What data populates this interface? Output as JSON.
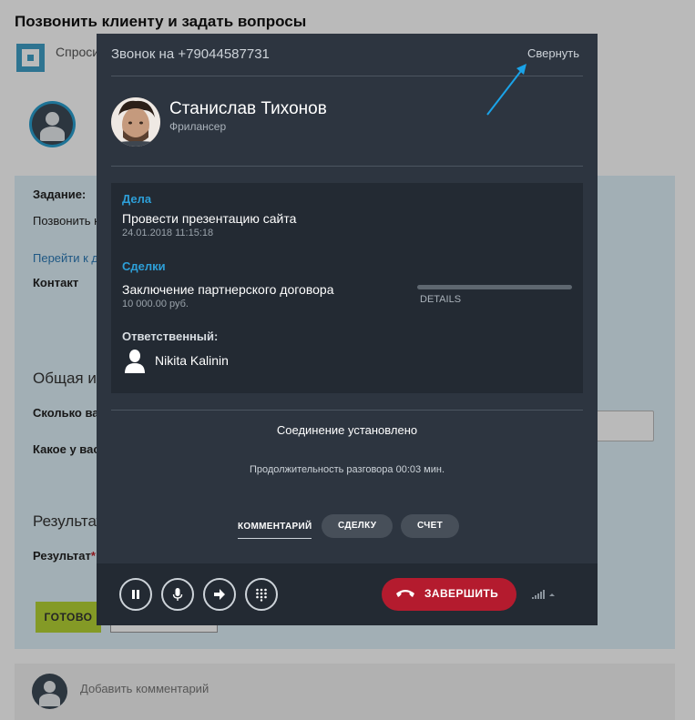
{
  "background": {
    "page_title": "Позвонить клиенту и задать вопросы",
    "ask_text": "Спроси",
    "task_label": "Задание:",
    "task_text": "Позвонить к",
    "goto_link": "Перейти к д",
    "contact_label": "Контакт",
    "general_heading": "Общая ин",
    "question1": "Сколько ва",
    "question2": "Какое у вас",
    "result_heading": "Результат",
    "result_label": "Результат",
    "required_mark": "*",
    "ready_button": "ГОТОВО",
    "add_comment": "Добавить комментарий"
  },
  "call_dialog": {
    "title": "Звонок на +79044587731",
    "collapse_label": "Свернуть",
    "caller": {
      "name": "Станислав Тихонов",
      "role": "Фрилансер"
    },
    "tasks": {
      "heading": "Дела",
      "items": [
        {
          "title": "Провести презентацию сайта",
          "date": "24.01.2018 11:15:18"
        }
      ]
    },
    "deals": {
      "heading": "Сделки",
      "items": [
        {
          "title": "Заключение партнерского договора",
          "amount": "10 000.00 руб.",
          "details_label": "DETAILS"
        }
      ]
    },
    "responsible": {
      "heading": "Ответственный:",
      "name": "Nikita Kalinin"
    },
    "status": "Соединение установлено",
    "duration": "Продолжительность разговора 00:03 мин.",
    "tabs": {
      "comment": "КОММЕНТАРИЙ",
      "deal": "СДЕЛКУ",
      "invoice": "СЧЕТ"
    },
    "controls": {
      "end_call": "ЗАВЕРШИТЬ"
    }
  },
  "colors": {
    "dialog_bg": "#2d3540",
    "accent_blue": "#2d9fd8",
    "end_call_red": "#b41b2e",
    "ready_green": "#b5d335",
    "annotation_arrow": "#1aa3e8"
  },
  "icons": [
    "pause-icon",
    "microphone-icon",
    "transfer-arrow-icon",
    "keypad-icon",
    "hangup-phone-icon",
    "signal-icon",
    "person-icon"
  ]
}
